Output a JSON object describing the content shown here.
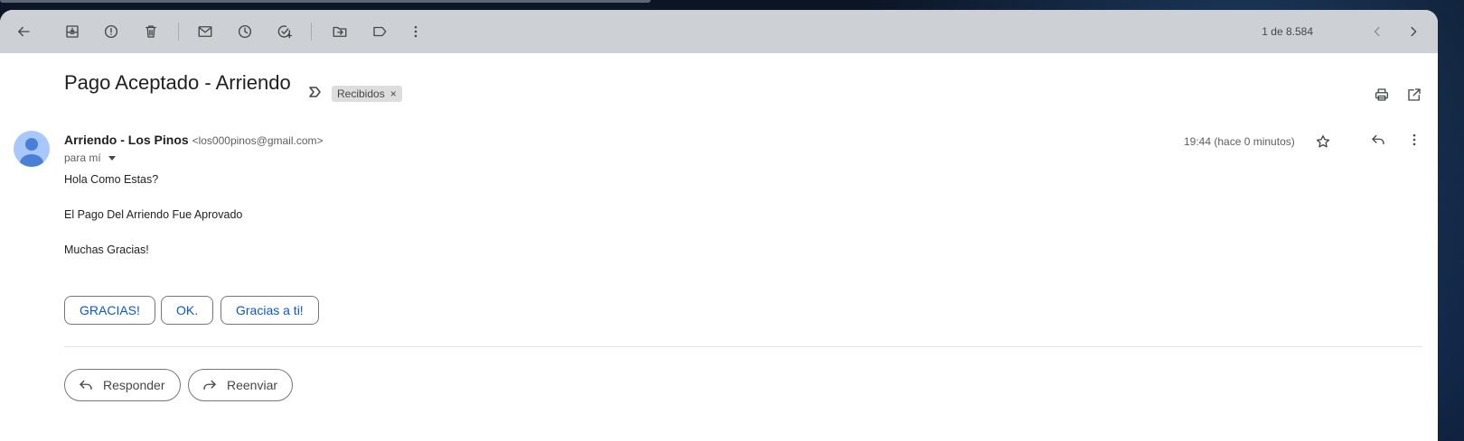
{
  "pager": {
    "text": "1 de 8.584"
  },
  "email": {
    "subject": "Pago Aceptado - Arriendo",
    "label": "Recibidos",
    "label_remove": "×",
    "sender_name": "Arriendo - Los Pinos",
    "sender_email": "<los000pinos@gmail.com>",
    "recipient": "para mí",
    "time": "19:44 (hace 0 minutos)",
    "body": [
      "Hola Como Estas?",
      "El Pago Del Arriendo Fue Aprovado",
      "Muchas Gracias!"
    ]
  },
  "smart_replies": [
    "GRACIAS!",
    "OK.",
    "Gracias a ti!"
  ],
  "actions": {
    "reply": "Responder",
    "forward": "Reenviar"
  },
  "icons": {
    "toolbar": [
      "back-arrow-icon",
      "archive-icon",
      "report-spam-icon",
      "delete-icon",
      "mark-unread-icon",
      "snooze-icon",
      "add-task-icon",
      "move-to-icon",
      "label-icon",
      "more-vert-icon"
    ],
    "header": [
      "print-icon",
      "open-new-window-icon",
      "star-icon",
      "reply-icon",
      "more-vert-icon"
    ]
  },
  "colors": {
    "toolbar_bg": "#cdd1d6",
    "link_blue": "#0b57d0",
    "avatar_bg": "#a8c7fa",
    "avatar_fg": "#4a7fd6"
  }
}
